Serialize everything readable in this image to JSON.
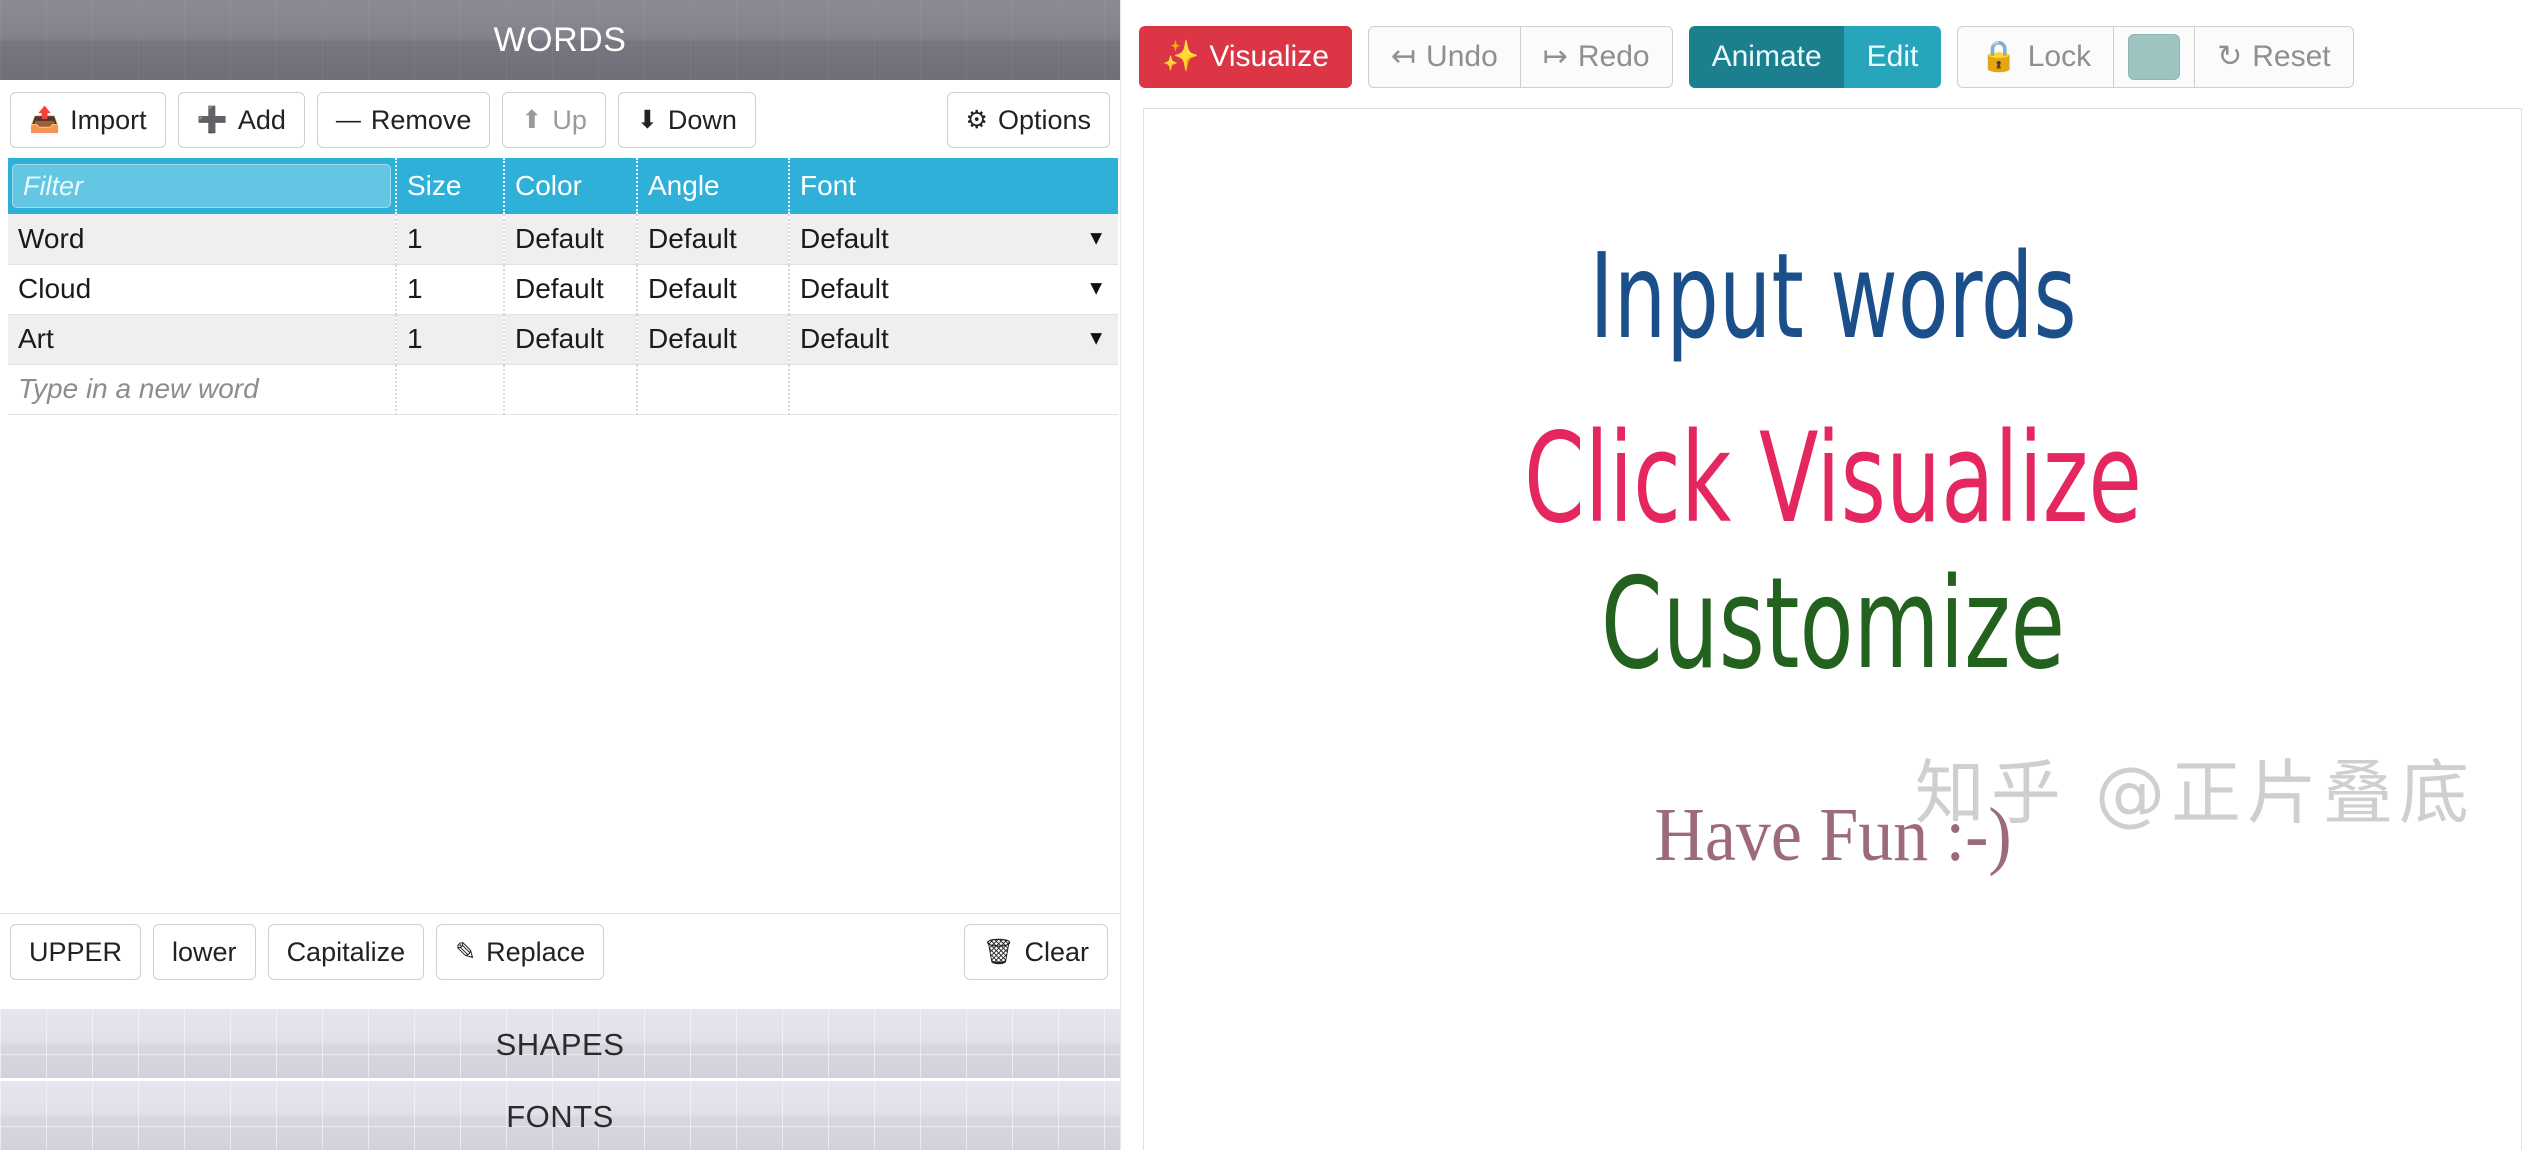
{
  "left_panel": {
    "heading": "WORDS",
    "toolbar": {
      "import_label": "Import",
      "import_icon": "import-file-icon",
      "add_label": "Add",
      "add_icon": "plus-icon",
      "remove_label": "Remove",
      "remove_icon": "minus-icon",
      "up_label": "Up",
      "up_icon": "arrow-up-icon",
      "down_label": "Down",
      "down_icon": "arrow-down-icon",
      "options_label": "Options",
      "options_icon": "gear-icon"
    },
    "table": {
      "filter_placeholder": "Filter",
      "filter_value": "",
      "columns": [
        "Size",
        "Color",
        "Angle",
        "Font"
      ],
      "rows": [
        {
          "word": "Word",
          "size": "1",
          "color": "Default",
          "angle": "Default",
          "font": "Default"
        },
        {
          "word": "Cloud",
          "size": "1",
          "color": "Default",
          "angle": "Default",
          "font": "Default"
        },
        {
          "word": "Art",
          "size": "1",
          "color": "Default",
          "angle": "Default",
          "font": "Default"
        }
      ],
      "new_row_placeholder": "Type in a new word",
      "dropdown_caret": "▼"
    },
    "case_toolbar": {
      "upper_label": "UPPER",
      "lower_label": "lower",
      "capitalize_label": "Capitalize",
      "replace_label": "Replace",
      "replace_icon": "edit-pencil-icon",
      "clear_label": "Clear",
      "clear_icon": "trash-icon"
    },
    "sections": [
      {
        "label": "SHAPES"
      },
      {
        "label": "FONTS"
      }
    ]
  },
  "right_panel": {
    "toolbar": {
      "visualize_label": "Visualize",
      "visualize_icon": "magic-wand-icon",
      "undo_label": "Undo",
      "undo_icon": "arrow-undo-icon",
      "redo_label": "Redo",
      "redo_icon": "arrow-redo-icon",
      "animate_label": "Animate",
      "edit_label": "Edit",
      "lock_label": "Lock",
      "lock_icon": "lock-icon",
      "swatch_color": "#9dc4c0",
      "reset_label": "Reset",
      "reset_icon": "refresh-icon"
    },
    "canvas": {
      "words": [
        {
          "text": "Input words",
          "color": "#1b4f8a"
        },
        {
          "text": "Click Visualize",
          "color": "#e5275f"
        },
        {
          "text": "Customize",
          "color": "#23611f"
        },
        {
          "text": "Have Fun :-)",
          "color": "#9d6b78"
        }
      ],
      "watermark": "知乎 @正片叠底"
    }
  },
  "colors": {
    "header_bg": "#7b7b86",
    "table_header": "#2fb0d9",
    "primary_red": "#dc3545",
    "teal_dark": "#1b7f8e",
    "teal_light": "#27a5bb"
  }
}
